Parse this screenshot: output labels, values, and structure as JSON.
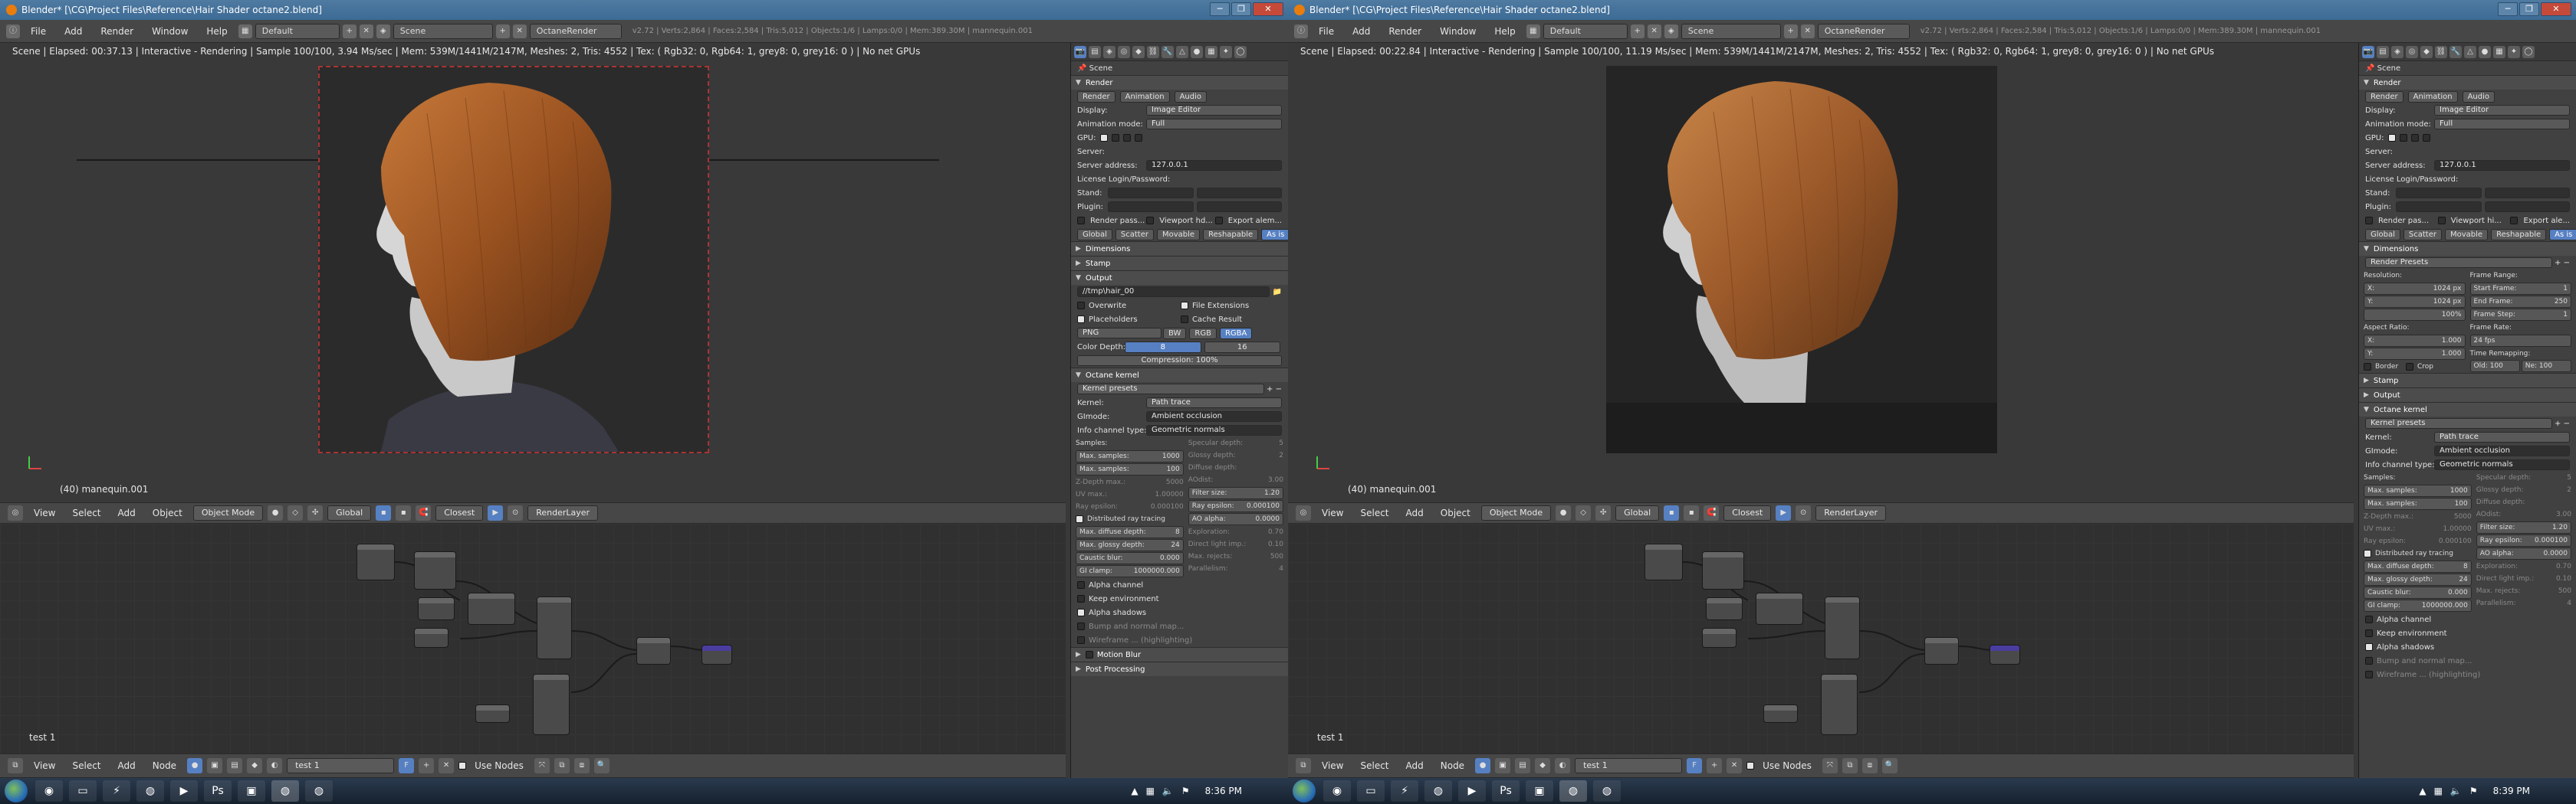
{
  "windows": [
    {
      "title": "Blender* [\\CG\\Project Files\\Reference\\Hair Shader octane2.blend]",
      "menus": [
        "File",
        "Add",
        "Render",
        "Window",
        "Help"
      ],
      "layout": "Default",
      "scene": "Scene",
      "engine": "OctaneRender",
      "stats": "v2.72 | Verts:2,864 | Faces:2,584 | Tris:5,012 | Objects:1/6 | Lamps:0/0 | Mem:389.30M | mannequin.001",
      "status": "Scene | Elapsed: 00:37.13 | Interactive - Rendering | Sample 100/100, 3.94 Ms/sec | Mem: 539M/1441M/2147M, Meshes: 2, Tris: 4552 | Tex: ( Rgb32: 0, Rgb64: 1, grey8: 0, grey16: 0 ) | No net GPUs",
      "object": "(40) manequin.001",
      "node_tree": "test 1",
      "clock": "8:36 PM"
    },
    {
      "title": "Blender* [\\CG\\Project Files\\Reference\\Hair Shader octane2.blend]",
      "menus": [
        "File",
        "Add",
        "Render",
        "Window",
        "Help"
      ],
      "layout": "Default",
      "scene": "Scene",
      "engine": "OctaneRender",
      "stats": "v2.72 | Verts:2,864 | Faces:2,584 | Tris:5,012 | Objects:1/6 | Lamps:0/0 | Mem:389.30M | mannequin.001",
      "status": "Scene | Elapsed: 00:22.84 | Interactive - Rendering | Sample 100/100, 11.19 Ms/sec | Mem: 539M/1441M/2147M, Meshes: 2, Tris: 4552 | Tex: ( Rgb32: 0, Rgb64: 1, grey8: 0, grey16: 0 ) | No net GPUs",
      "object": "(40) manequin.001",
      "node_tree": "test 1",
      "clock": "8:39 PM"
    }
  ],
  "viewport_header": {
    "view": "View",
    "select": "Select",
    "add": "Add",
    "object": "Object",
    "mode": "Object Mode",
    "orientation": "Global",
    "pivot": "Closest",
    "render_layer": "RenderLayer"
  },
  "node_header": {
    "view": "View",
    "select": "Select",
    "add": "Add",
    "node": "Node",
    "tree": "test 1",
    "use_nodes": "Use Nodes"
  },
  "props_left": {
    "scene_label": "Scene",
    "render_header": "Render",
    "tabs": [
      "Render",
      "Animation",
      "Audio"
    ],
    "display_key": "Display:",
    "display_val": "Image Editor",
    "anim_key": "Animation mode:",
    "anim_val": "Full",
    "gpu_label": "GPU:",
    "server_label": "Server:",
    "server_addr_key": "Server address:",
    "server_addr_val": "127.0.0.1",
    "license_label": "License Login/Password:",
    "stand_label": "Stand:",
    "plugin_label": "Plugin:",
    "passes": [
      "Render pass...",
      "Viewport hd...",
      "Export alem..."
    ],
    "modes": [
      "Global",
      "Scatter",
      "Movable",
      "Reshapable",
      "As is"
    ],
    "dimensions": "Dimensions",
    "stamp": "Stamp",
    "output": "Output",
    "output_path": "//tmp\\hair_00",
    "overwrite": "Overwrite",
    "file_ext": "File Extensions",
    "placeholders": "Placeholders",
    "cache_result": "Cache Result",
    "format": "PNG",
    "bw": "BW",
    "rgb": "RGB",
    "rgba": "RGBA",
    "color_depth_key": "Color Depth:",
    "color_depth_a": "8",
    "color_depth_b": "16",
    "compression_key": "Compression:",
    "compression_val": "100%",
    "kernel_header": "Octane kernel",
    "kernel_presets": "Kernel presets",
    "kernel_key": "Kernel:",
    "kernel_val": "Path trace",
    "gimode_key": "GImode:",
    "gimode_val": "Ambient occlusion",
    "info_key": "Info channel type:",
    "info_val": "Geometric normals",
    "samples_label": "Samples:",
    "left_col": [
      [
        "Max. samples:",
        "1000"
      ],
      [
        "Max. samples:",
        "100"
      ],
      [
        "Z-Depth max.:",
        "5000"
      ],
      [
        "UV max.:",
        "1.00000"
      ],
      [
        "Ray epsilon:",
        "0.000100"
      ]
    ],
    "right_col": [
      [
        "Specular depth:",
        "5"
      ],
      [
        "Glossy depth:",
        "2"
      ],
      [
        "Diffuse depth:",
        ""
      ],
      [
        "AOdist:",
        "3.00"
      ],
      [
        "Filter size:",
        "1.20"
      ],
      [
        "Ray epsilon:",
        "0.000100"
      ],
      [
        "AO alpha:",
        "0.0000"
      ],
      [
        "Exploration:",
        "0.70"
      ],
      [
        "Direct light imp.:",
        "0.10"
      ],
      [
        "Max. rejects:",
        "500"
      ],
      [
        "Parallelism:",
        "4"
      ]
    ],
    "distributed": "Distributed ray tracing",
    "diffuse_depth": [
      "Max. diffuse depth:",
      "8"
    ],
    "glossy_depth": [
      "Max. glossy depth:",
      "24"
    ],
    "caustic_blur": [
      "Caustic blur:",
      "0.000"
    ],
    "gi_clamp": [
      "GI clamp:",
      "1000000.000"
    ],
    "alpha_channel": "Alpha channel",
    "keep_env": "Keep environment",
    "alpha_shadows": "Alpha shadows",
    "bump": "Bump and normal map...",
    "wireframe": "Wireframe ... (highlighting)",
    "motion_blur": "Motion Blur",
    "post_processing": "Post Processing"
  },
  "props_right": {
    "scene_label": "Scene",
    "render_header": "Render",
    "tabs": [
      "Render",
      "Animation",
      "Audio"
    ],
    "display_key": "Display:",
    "display_val": "Image Editor",
    "anim_key": "Animation mode:",
    "anim_val": "Full",
    "gpu_label": "GPU:",
    "server_label": "Server:",
    "server_addr_key": "Server address:",
    "server_addr_val": "127.0.0.1",
    "license_label": "License Login/Password:",
    "stand_label": "Stand:",
    "plugin_label": "Plugin:",
    "passes": [
      "Render pas...",
      "Viewport hi...",
      "Export ale..."
    ],
    "modes": [
      "Global",
      "Scatter",
      "Movable",
      "Reshapable",
      "As is"
    ],
    "dimensions": "Dimensions",
    "render_presets": "Render Presets",
    "resolution": "Resolution:",
    "res_x": "1024 px",
    "res_y": "1024 px",
    "res_pct": "100%",
    "frame_range": "Frame Range:",
    "start": [
      "Start Frame:",
      "1"
    ],
    "end": [
      "End Frame:",
      "250"
    ],
    "step": [
      "Frame Step:",
      "1"
    ],
    "aspect": "Aspect Ratio:",
    "aspect_x": "1.000",
    "aspect_y": "1.000",
    "frame_rate": "Frame Rate:",
    "fps": "24 fps",
    "time_remap": "Time Remapping:",
    "old": "Old: 100",
    "new": "Ne: 100",
    "border": "Border",
    "crop": "Crop",
    "stamp": "Stamp",
    "output": "Output",
    "kernel_header": "Octane kernel",
    "kernel_presets": "Kernel presets",
    "kernel_key": "Kernel:",
    "kernel_val": "Path trace",
    "gimode_key": "GImode:",
    "gimode_val": "Ambient occlusion",
    "info_key": "Info channel type:",
    "info_val": "Geometric normals",
    "samples_label": "Samples:",
    "left_col": [
      [
        "Max. samples:",
        "1000"
      ],
      [
        "Max. samples:",
        "100"
      ],
      [
        "Z-Depth max.:",
        "5000"
      ],
      [
        "UV max.:",
        "1.00000"
      ],
      [
        "Ray epsilon:",
        "0.000100"
      ]
    ],
    "right_col": [
      [
        "Specular depth:",
        "5"
      ],
      [
        "Glossy depth:",
        "2"
      ],
      [
        "Diffuse depth:",
        ""
      ],
      [
        "AOdist:",
        "3.00"
      ],
      [
        "Filter size:",
        "1.20"
      ],
      [
        "Ray epsilon:",
        "0.000100"
      ],
      [
        "AO alpha:",
        "0.0000"
      ],
      [
        "Exploration:",
        "0.70"
      ],
      [
        "Direct light imp.:",
        "0.10"
      ],
      [
        "Max. rejects:",
        "500"
      ],
      [
        "Parallelism:",
        "4"
      ]
    ],
    "distributed": "Distributed ray tracing",
    "diffuse_depth": [
      "Max. diffuse depth:",
      "8"
    ],
    "glossy_depth": [
      "Max. glossy depth:",
      "24"
    ],
    "caustic_blur": [
      "Caustic blur:",
      "0.000"
    ],
    "gi_clamp": [
      "GI clamp:",
      "1000000.000"
    ],
    "alpha_channel": "Alpha channel",
    "keep_env": "Keep environment",
    "alpha_shadows": "Alpha shadows",
    "bump": "Bump and normal map...",
    "wireframe": "Wireframe ... (highlighting)"
  },
  "taskbar_icons": [
    "start-orb",
    "chrome",
    "folder",
    "winamp",
    "blender",
    "media",
    "photoshop",
    "app",
    "app",
    "blender",
    "blender"
  ],
  "colors": {
    "accent": "#5680c2",
    "titlebar": "#3c6b95",
    "hair": "#a55a25",
    "panel": "#414141"
  }
}
